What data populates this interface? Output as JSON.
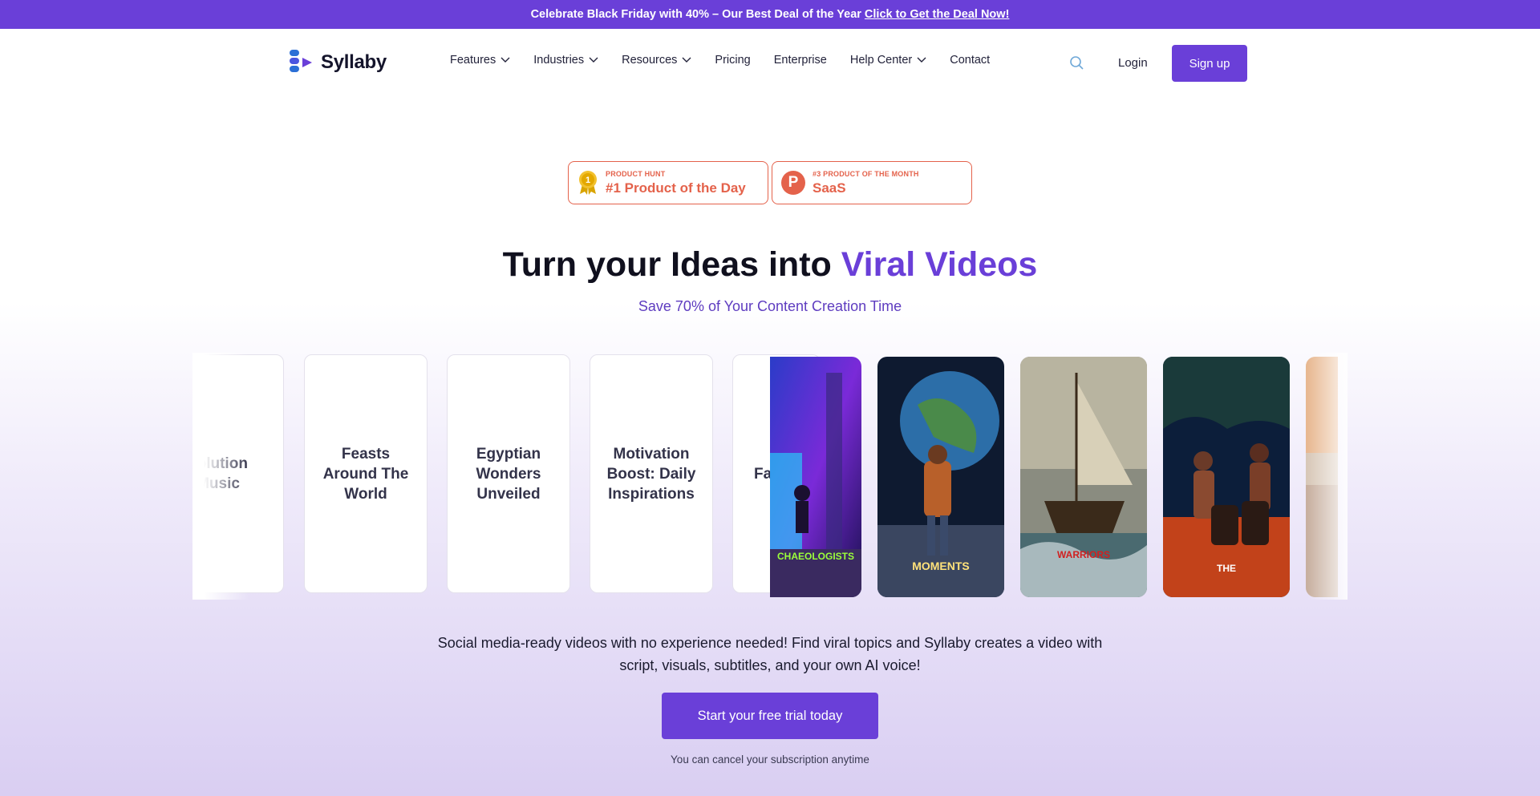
{
  "promo": {
    "text": "Celebrate Black Friday with 40% – Our Best Deal of the Year",
    "link": "Click to Get the Deal Now!"
  },
  "nav": {
    "brand": "Syllaby",
    "items": [
      {
        "label": "Features",
        "dropdown": true
      },
      {
        "label": "Industries",
        "dropdown": true
      },
      {
        "label": "Resources",
        "dropdown": true
      },
      {
        "label": "Pricing",
        "dropdown": false
      },
      {
        "label": "Enterprise",
        "dropdown": false
      },
      {
        "label": "Help Center",
        "dropdown": true
      },
      {
        "label": "Contact",
        "dropdown": false
      }
    ],
    "login": "Login",
    "signup": "Sign up"
  },
  "badges": [
    {
      "small": "PRODUCT HUNT",
      "big": "#1 Product of the Day",
      "icon": "medal-icon"
    },
    {
      "small": "#3 PRODUCT OF THE MONTH",
      "big": "SaaS",
      "icon": "product-hunt-icon",
      "icon_letter": "P"
    }
  ],
  "hero": {
    "title_prefix": "Turn your Ideas into",
    "title_accent": "Viral Videos",
    "subtitle": "Save 70% of Your Content Creation Time"
  },
  "topic_cards": [
    "volution Music",
    "Feasts Around The World",
    "Egyptian Wonders Unveiled",
    "Motivation Boost: Daily Inspirations",
    "Fa F Yo"
  ],
  "video_captions": [
    "CHAEOLOGISTS",
    "MOMENTS",
    "WARRIORS",
    "THE"
  ],
  "description": "Social media-ready videos with no experience needed! Find viral topics and Syllaby creates a video with script, visuals, subtitles, and your own AI voice!",
  "cta": "Start your free trial today",
  "cancel_note": "You can cancel your subscription anytime",
  "colors": {
    "brand": "#6a3fd8",
    "badge": "#e4624b"
  }
}
